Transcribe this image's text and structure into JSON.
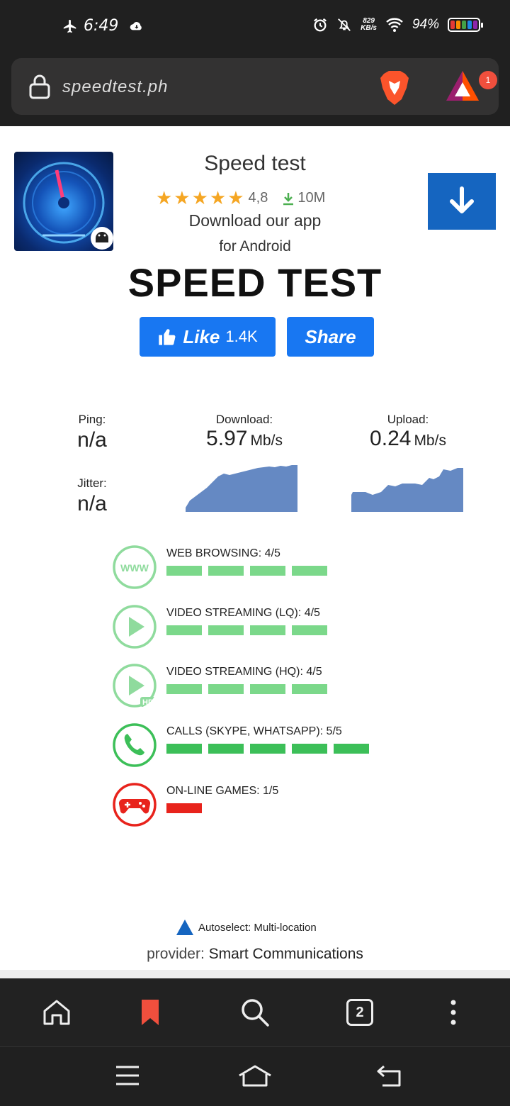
{
  "status_bar": {
    "time": "6:49",
    "net_speed_value": "829",
    "net_speed_unit": "KB/s",
    "battery": "94%"
  },
  "browser": {
    "url": "speedtest.ph",
    "rewards_badge": "1",
    "tabs_count": "2"
  },
  "app_promo": {
    "title": "Speed test",
    "rating": "4,8",
    "downloads": "10M",
    "line1": "Download our app",
    "line2": "for Android"
  },
  "page": {
    "title": "SPEED TEST",
    "like_label": "Like",
    "like_count": "1.4K",
    "share_label": "Share"
  },
  "results": {
    "ping_label": "Ping:",
    "ping_value": "n/a",
    "jitter_label": "Jitter:",
    "jitter_value": "n/a",
    "download_label": "Download:",
    "download_value": "5.97",
    "download_unit": "Mb/s",
    "upload_label": "Upload:",
    "upload_value": "0.24",
    "upload_unit": "Mb/s"
  },
  "quality": [
    {
      "label": "WEB BROWSING: 4/5",
      "score": 4,
      "color": "#7bd88a",
      "icon": "www-icon"
    },
    {
      "label": "VIDEO STREAMING (LQ): 4/5",
      "score": 4,
      "color": "#7bd88a",
      "icon": "play-icon"
    },
    {
      "label": "VIDEO STREAMING (HQ): 4/5",
      "score": 4,
      "color": "#7bd88a",
      "icon": "play-hd-icon"
    },
    {
      "label": "CALLS (SKYPE, WHATSAPP): 5/5",
      "score": 5,
      "color": "#3cbf58",
      "icon": "phone-icon"
    },
    {
      "label": "ON-LINE GAMES: 1/5",
      "score": 1,
      "color": "#e8231c",
      "icon": "gamepad-icon"
    }
  ],
  "server": {
    "autoselect": "Autoselect: Multi-location",
    "provider_label": "provider:",
    "provider_name": "Smart Communications"
  },
  "colors": {
    "accent_blue": "#1877f2",
    "graph_fill": "#6589c3",
    "good_green": "#7bd88a",
    "great_green": "#3cbf58",
    "bad_red": "#e8231c"
  }
}
